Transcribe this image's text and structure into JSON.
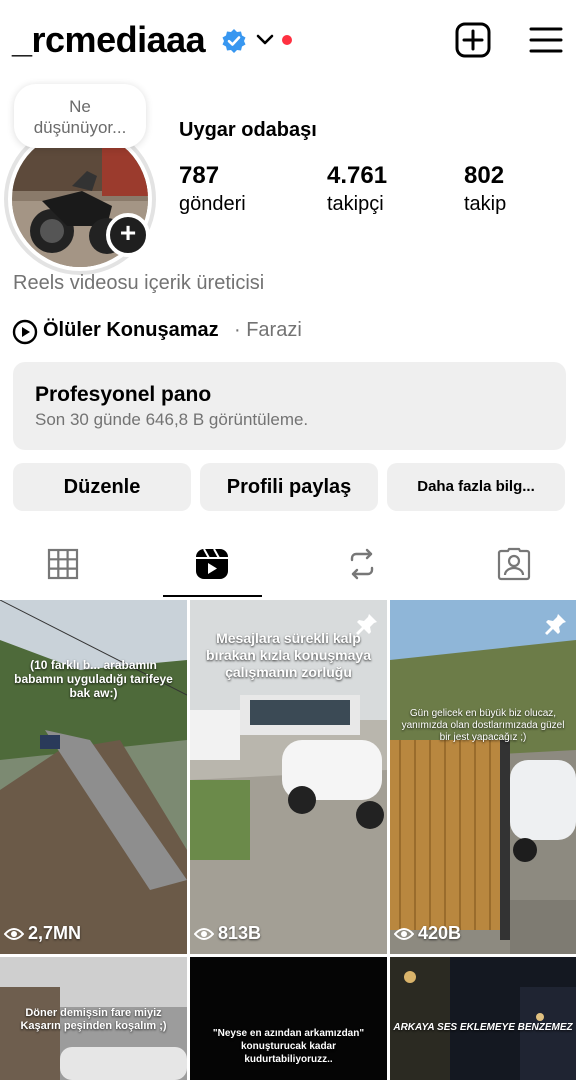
{
  "header": {
    "username": "_rcmediaaa",
    "colors": {
      "verified": "#3897f0",
      "notification_dot": "#ff3040"
    }
  },
  "profile": {
    "note": [
      "Ne",
      "düşünüyor..."
    ],
    "display_name": "Uygar odabaşı",
    "stats": [
      {
        "value": "787",
        "label": "gönderi"
      },
      {
        "value": "4.761",
        "label": "takipçi"
      },
      {
        "value": "802",
        "label": "takip"
      }
    ],
    "category": "Reels videosu içerik üreticisi",
    "music": {
      "title": "Ölüler Konuşamaz",
      "artist": "· Farazi"
    }
  },
  "dashboard": {
    "title": "Profesyonel pano",
    "subtitle": "Son 30 günde 646,8 B görüntüleme."
  },
  "buttons": {
    "edit": "Düzenle",
    "share": "Profili paylaş",
    "more": "Daha fazla bilg..."
  },
  "tabs": [
    {
      "icon": "grid-icon",
      "active": false
    },
    {
      "icon": "reels-icon",
      "active": true
    },
    {
      "icon": "reposts-icon",
      "active": false
    },
    {
      "icon": "tagged-icon",
      "active": false
    }
  ],
  "grid": [
    {
      "caption": "(10 farklı b... arabamın babamın uyguladığı tarifeye bak aw:)",
      "views": "2,7MN",
      "pinned": false
    },
    {
      "caption": "Mesajlara sürekli kalp bırakan kızla konuşmaya çalışmanın zorluğu",
      "views": "813B",
      "pinned": true
    },
    {
      "caption": "Gün gelicek en büyük biz olucaz, yanımızda olan dostlarımızada güzel bir jest yapacağız ;)",
      "views": "420B",
      "pinned": true
    },
    {
      "caption": "Döner demişsin fare miyiz Kaşarın peşinden koşalım ;)",
      "views": "",
      "pinned": false
    },
    {
      "caption": "\"Neyse en azından arkamızdan\" konuşturucak kadar kudurtabiliyoruzz..",
      "views": "",
      "pinned": false
    },
    {
      "caption": "ARKAYA SES EKLEMEYE BENZEMEZ",
      "views": "",
      "pinned": false
    }
  ]
}
